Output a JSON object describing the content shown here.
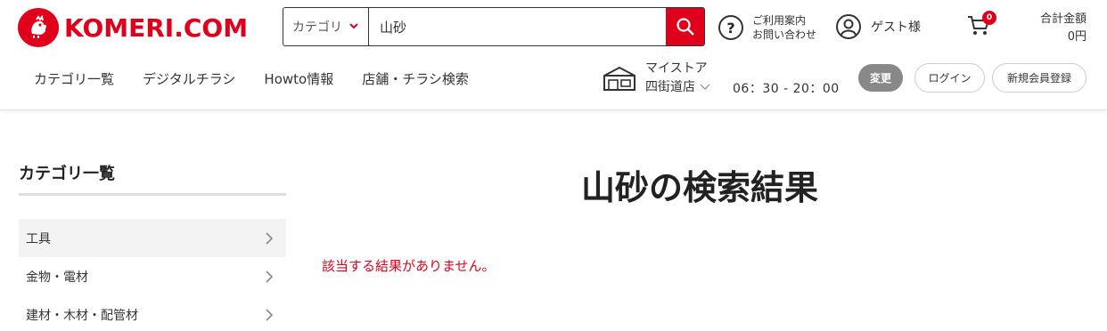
{
  "brand": {
    "logo_text": "KOMERI.COM",
    "accent_color": "#e0001b"
  },
  "search": {
    "category_label": "カテゴリ",
    "value": "山砂",
    "button_icon": "search-icon"
  },
  "header": {
    "help_line1": "ご利用案内",
    "help_line2": "お問い合わせ",
    "guest_label": "ゲスト様",
    "cart_count": "0",
    "total_label": "合計金額",
    "total_value": "0円"
  },
  "nav": {
    "items": [
      "カテゴリ一覧",
      "デジタルチラシ",
      "Howto情報",
      "店舗・チラシ検索"
    ]
  },
  "store": {
    "label": "マイストア",
    "name": "四街道店",
    "hours": "06：30 - 20：00",
    "change_label": "変更"
  },
  "account": {
    "login_label": "ログイン",
    "register_label": "新規会員登録"
  },
  "sidebar": {
    "title": "カテゴリ一覧",
    "items": [
      {
        "label": "工具"
      },
      {
        "label": "金物・電材"
      },
      {
        "label": "建材・木材・配管材"
      }
    ]
  },
  "main": {
    "title": "山砂の検索結果",
    "message": "該当する結果がありません。"
  }
}
